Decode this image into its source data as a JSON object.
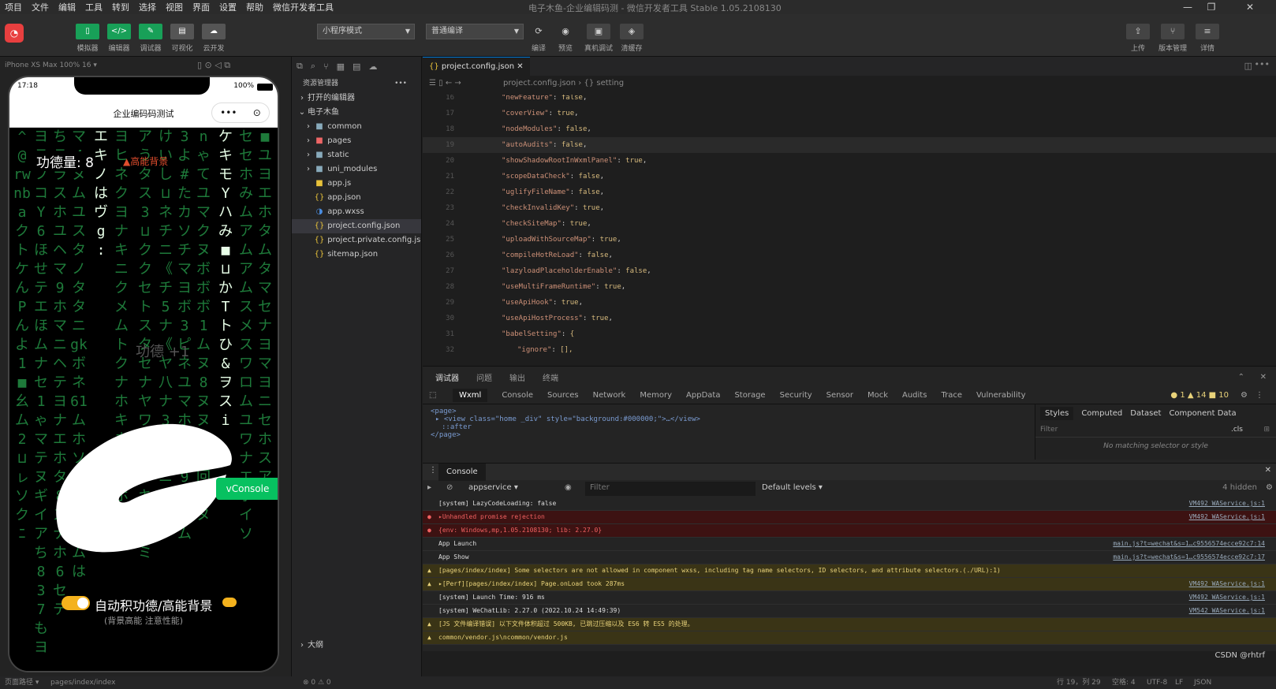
{
  "menu": {
    "items": [
      "项目",
      "文件",
      "编辑",
      "工具",
      "转到",
      "选择",
      "视图",
      "界面",
      "设置",
      "帮助",
      "微信开发者工具"
    ],
    "window_title": "电子木鱼-企业编辑码测 - 微信开发者工具 Stable 1.05.2108130"
  },
  "toolbar": {
    "buttons": [
      {
        "label": "模拟器",
        "icon": "phone-icon"
      },
      {
        "label": "编辑器",
        "icon": "code-icon"
      },
      {
        "label": "调试器",
        "icon": "debug-icon"
      },
      {
        "label": "可视化",
        "icon": "visual-icon"
      },
      {
        "label": "云开发",
        "icon": "cloud-icon"
      }
    ],
    "mode_select": "小程序模式",
    "compile_select": "普通编译",
    "right_labels": [
      "编译",
      "预览",
      "真机调试",
      "清缓存"
    ],
    "far_right": [
      "上传",
      "版本管理",
      "详情"
    ]
  },
  "simulator": {
    "device": "iPhone XS Max 100% 16 ▾",
    "time": "17:18",
    "battery": "100%",
    "nav_title": "企业编码码测试",
    "merit_text": "功德量: 8",
    "bg_tag": "▲高能背景",
    "vconsole": "vConsole",
    "toggle_label": "自动积功德/高能背景",
    "toggle_sub": "(背景高能 注意性能)",
    "faint_text": "功德 +1"
  },
  "explorer": {
    "title": "资源管理器",
    "sections": [
      "打开的编辑器",
      "电子木鱼"
    ],
    "tree": [
      {
        "name": "common",
        "type": "folder"
      },
      {
        "name": "pages",
        "type": "folder"
      },
      {
        "name": "static",
        "type": "folder"
      },
      {
        "name": "uni_modules",
        "type": "folder"
      },
      {
        "name": "app.js",
        "type": "js"
      },
      {
        "name": "app.json",
        "type": "json"
      },
      {
        "name": "app.wxss",
        "type": "wxss"
      },
      {
        "name": "project.config.json",
        "type": "json",
        "active": true
      },
      {
        "name": "project.private.config.js...",
        "type": "json"
      },
      {
        "name": "sitemap.json",
        "type": "json"
      }
    ],
    "outline": "大纲"
  },
  "editor": {
    "tab": "project.config.json",
    "breadcrumb": "project.config.json › {} setting",
    "current_line": "19",
    "lines": [
      {
        "n": "16",
        "key": "newFeature",
        "val": "false"
      },
      {
        "n": "17",
        "key": "coverView",
        "val": "true"
      },
      {
        "n": "18",
        "key": "nodeModules",
        "val": "false"
      },
      {
        "n": "19",
        "key": "autoAudits",
        "val": "false"
      },
      {
        "n": "20",
        "key": "showShadowRootInWxmlPanel",
        "val": "true"
      },
      {
        "n": "21",
        "key": "scopeDataCheck",
        "val": "false"
      },
      {
        "n": "22",
        "key": "uglifyFileName",
        "val": "false"
      },
      {
        "n": "23",
        "key": "checkInvalidKey",
        "val": "true"
      },
      {
        "n": "24",
        "key": "checkSiteMap",
        "val": "true"
      },
      {
        "n": "25",
        "key": "uploadWithSourceMap",
        "val": "true"
      },
      {
        "n": "26",
        "key": "compileHotReLoad",
        "val": "false"
      },
      {
        "n": "27",
        "key": "lazyloadPlaceholderEnable",
        "val": "false"
      },
      {
        "n": "28",
        "key": "useMultiFrameRuntime",
        "val": "true"
      },
      {
        "n": "29",
        "key": "useApiHook",
        "val": "true"
      },
      {
        "n": "30",
        "key": "useApiHostProcess",
        "val": "true"
      },
      {
        "n": "31",
        "key": "babelSetting",
        "val": "{"
      },
      {
        "n": "32",
        "key": "ignore",
        "val": "[],"
      }
    ]
  },
  "devtools": {
    "top_tabs": [
      "调试器",
      "问题",
      "输出",
      "终端"
    ],
    "tabs": [
      "Wxml",
      "Console",
      "Sources",
      "Network",
      "Memory",
      "AppData",
      "Storage",
      "Security",
      "Sensor",
      "Mock",
      "Audits",
      "Trace",
      "Vulnerability"
    ],
    "counts": "● 1 ▲ 14 ■ 10",
    "elements": [
      "<page>",
      "▸ <view class=\"home _div\" style=\"background:#000000;\">…</view>",
      "::after",
      "</page>"
    ],
    "style_tabs": [
      "Styles",
      "Computed",
      "Dataset",
      "Component Data"
    ],
    "filter": "Filter",
    "cls": ".cls",
    "no_match": "No matching selector or style",
    "console_tab": "Console",
    "context": "appservice",
    "filter_ph": "Filter",
    "levels": "Default levels ▾",
    "hidden": "4 hidden",
    "logs": [
      {
        "type": "log",
        "text": "[system] LazyCodeLoading: false",
        "src": "VM492 WAService.js:1"
      },
      {
        "type": "err",
        "text": "▸Unhandled promise rejection",
        "src": "VM492 WAService.js:1"
      },
      {
        "type": "err",
        "text": "{env: Windows,mp,1.05.2108130; lib: 2.27.0}",
        "src": ""
      },
      {
        "type": "log",
        "text": "App Launch",
        "src": "main.js?t=wechat&s=1…c9556574ecce92c7:14"
      },
      {
        "type": "log",
        "text": "App Show",
        "src": "main.js?t=wechat&s=1…c9556574ecce92c7:17"
      },
      {
        "type": "warn",
        "text": "[pages/index/index] Some selectors are not allowed in component wxss, including tag name selectors, ID selectors, and attribute selectors.(./URL):1)",
        "src": ""
      },
      {
        "type": "warn",
        "text": "▸[Perf][pages/index/index] Page.onLoad took 287ms",
        "src": "VM492 WAService.js:1"
      },
      {
        "type": "log",
        "text": "[system] Launch Time: 916 ms",
        "src": "VM492 WAService.js:1"
      },
      {
        "type": "log",
        "text": "[system] WeChatLib: 2.27.0 (2022.10.24 14:49:39)",
        "src": "VM542 WAService.js:1"
      },
      {
        "type": "warn",
        "text": "[JS 文件编译错误] 以下文件体积超过 500KB, 已跳过压缩以及 ES6 转 ES5 的处理。",
        "src": ""
      },
      {
        "type": "warn",
        "text": "common/vendor.js\\ncommon/vendor.js",
        "src": ""
      }
    ]
  },
  "statusbar": {
    "left": [
      "页面路径 ▾",
      "pages/index/index"
    ],
    "problems": "⊗ 0 ⚠ 0",
    "right": [
      "行 19，列 29",
      "空格: 4",
      "UTF-8",
      "LF",
      "JSON"
    ],
    "watermark": "CSDN @rhtrf"
  },
  "colors": {
    "accent": "#18a058",
    "vconsole": "#07c160",
    "toggle": "#f4b21d",
    "error_bg": "#3d1212",
    "warn_bg": "#3a3416"
  }
}
